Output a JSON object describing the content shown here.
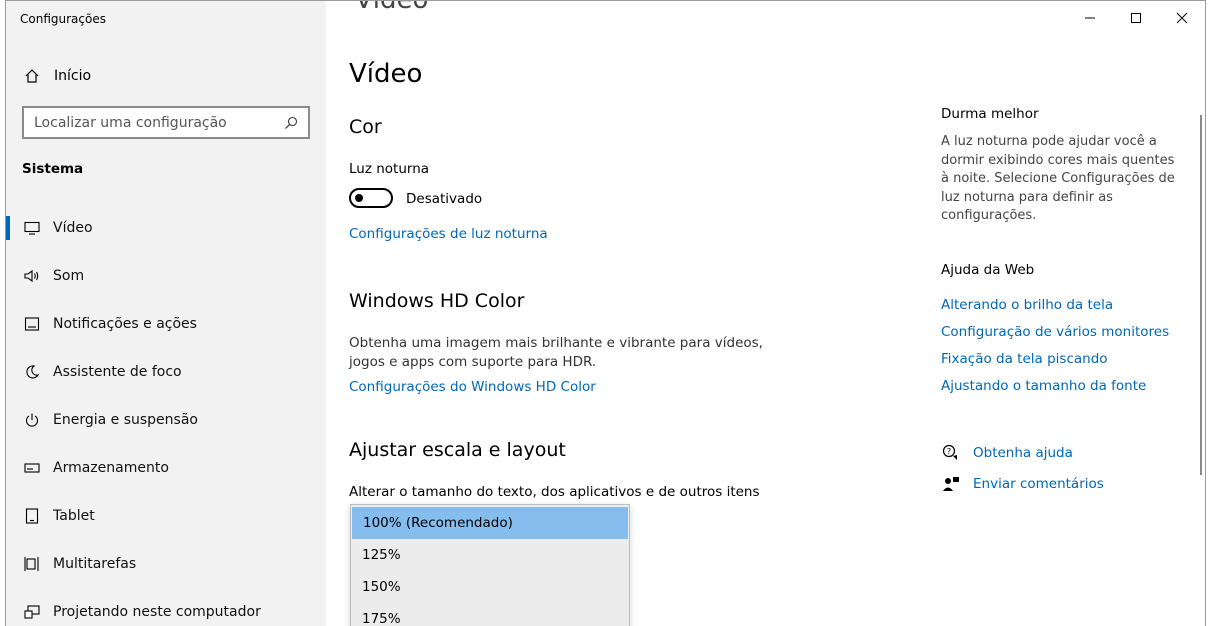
{
  "window": {
    "title": "Configurações",
    "ghost_heading": "Vídeo"
  },
  "sidebar": {
    "home_label": "Início",
    "search_placeholder": "Localizar uma configuração",
    "section_label": "Sistema",
    "items": [
      {
        "label": "Vídeo",
        "icon": "monitor-icon",
        "selected": true
      },
      {
        "label": "Som",
        "icon": "speaker-icon"
      },
      {
        "label": "Notificações e ações",
        "icon": "notification-icon"
      },
      {
        "label": "Assistente de foco",
        "icon": "moon-icon"
      },
      {
        "label": "Energia e suspensão",
        "icon": "power-icon"
      },
      {
        "label": "Armazenamento",
        "icon": "storage-icon"
      },
      {
        "label": "Tablet",
        "icon": "tablet-icon"
      },
      {
        "label": "Multitarefas",
        "icon": "multitask-icon"
      },
      {
        "label": "Projetando neste computador",
        "icon": "projector-icon"
      }
    ]
  },
  "main": {
    "title": "Vídeo",
    "color_section": {
      "heading": "Cor",
      "night_light_label": "Luz noturna",
      "toggle_state": "Desativado",
      "night_light_link": "Configurações de luz noturna"
    },
    "hdr_section": {
      "heading": "Windows HD Color",
      "description": "Obtenha uma imagem mais brilhante e vibrante para vídeos, jogos e apps com suporte para HDR.",
      "link": "Configurações do Windows HD Color"
    },
    "scale_section": {
      "heading": "Ajustar escala e layout",
      "label": "Alterar o tamanho do texto, dos aplicativos e de outros itens",
      "options": [
        "100% (Recomendado)",
        "125%",
        "150%",
        "175%"
      ],
      "selected": "100% (Recomendado)"
    }
  },
  "right_panel": {
    "sleep_title": "Durma melhor",
    "sleep_text": "A luz noturna pode ajudar você a dormir exibindo cores mais quentes à noite. Selecione Configurações de luz noturna para definir as configurações.",
    "web_help_title": "Ajuda da Web",
    "web_links": [
      "Alterando o brilho da tela",
      "Configuração de vários monitores",
      "Fixação da tela piscando",
      "Ajustando o tamanho da fonte"
    ],
    "get_help": "Obtenha ajuda",
    "feedback": "Enviar comentários"
  },
  "colors": {
    "accent": "#0067b8",
    "sidebar_bg": "#f2f2f2",
    "dropdown_highlight": "#84bdee"
  }
}
